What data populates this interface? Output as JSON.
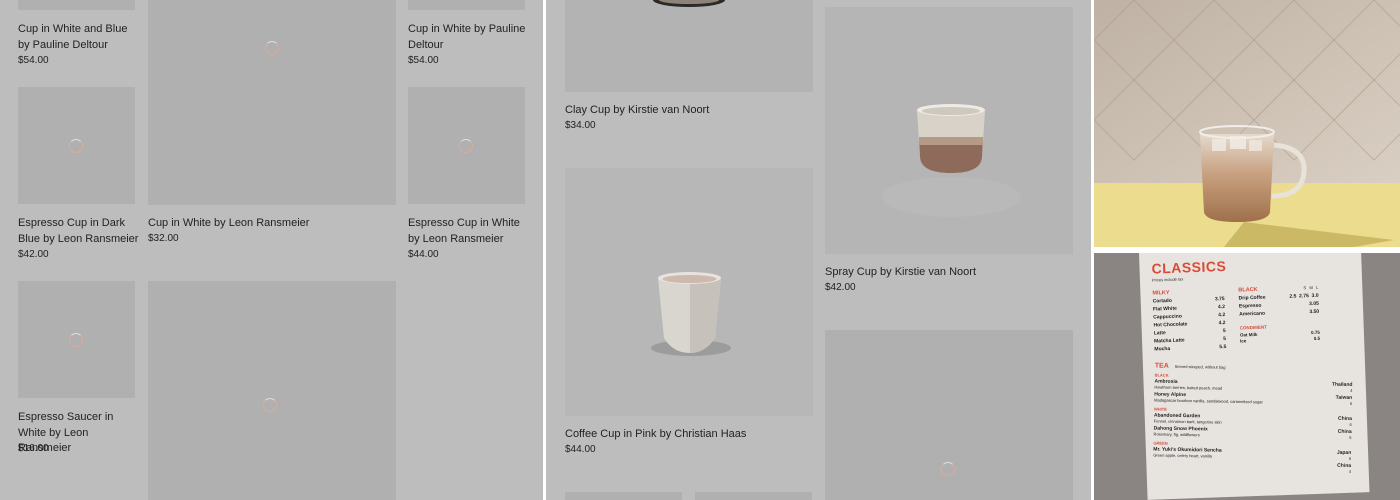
{
  "panel_a": {
    "products": [
      {
        "title": "Cup in White and Blue by Pauline Deltour",
        "price": "$54.00"
      },
      {
        "title": "Cup in White by Pauline Deltour",
        "price": "$54.00"
      },
      {
        "title": "Espresso Cup in Dark Blue by Leon Ransmeier",
        "price": "$42.00"
      },
      {
        "title": "Cup in White by Leon Ransmeier",
        "price": "$32.00"
      },
      {
        "title": "Espresso Cup in White by Leon Ransmeier",
        "price": "$44.00"
      },
      {
        "title": "Espresso Saucer in White by Leon Ransmeier",
        "price": "$16.00"
      }
    ]
  },
  "panel_b": {
    "products": [
      {
        "title": "Clay Cup by Kirstie van Noort",
        "price": "$34.00"
      },
      {
        "title": "Spray Cup by Kirstie van Noort",
        "price": "$42.00"
      },
      {
        "title": "Coffee Cup in Pink by Christian Haas",
        "price": "$44.00"
      }
    ]
  },
  "panel_c": {
    "menu": {
      "heading": "CLASSICS",
      "subheading": "Prices include tax",
      "milky_label": "MILKY",
      "milky_items": [
        {
          "name": "Cortado",
          "price": "3.75"
        },
        {
          "name": "Flat White",
          "price": "4.2"
        },
        {
          "name": "Cappuccino",
          "price": "4.2"
        },
        {
          "name": "Hot Chocolate",
          "price": "4.2"
        },
        {
          "name": "Latte",
          "price": "5"
        },
        {
          "name": "Matcha Latte",
          "price": "5"
        },
        {
          "name": "Mocha",
          "price": "5.5"
        }
      ],
      "black_label": "BLACK",
      "black_sizes": "S   M   L",
      "black_items": [
        {
          "name": "Drip Coffee",
          "price": "2.5  2.75  3.0"
        },
        {
          "name": "Espresso",
          "price": "3.05"
        },
        {
          "name": "Americano",
          "price": "3.50"
        }
      ],
      "condiment_label": "CONDIMENT",
      "condiment_items": [
        {
          "name": "Oat Milk",
          "price": "0.75"
        },
        {
          "name": "Ice",
          "price": "0.5"
        }
      ],
      "tea_label": "TEA",
      "tea_note": "Served steeped, without bag",
      "tea_black_label": "BLACK",
      "tea_items": [
        {
          "name": "Ambrosia",
          "desc": "Hawthorn berries, baked peach, mead",
          "origin": "Thailand",
          "price": "4"
        },
        {
          "name": "Honey Alpine",
          "desc": "Madagascar bourbon vanilla, sandalwood, caramelized sugar",
          "origin": "Taiwan",
          "price": "6"
        }
      ],
      "tea_white_label": "WHITE",
      "tea_white_items": [
        {
          "name": "Abandoned Garden",
          "desc": "Fennel, cinnamon bark, tangerine skin",
          "origin": "China",
          "price": "6"
        },
        {
          "name": "Dahong Snow Phoenix",
          "desc": "Rosemary, fig, wildflowers",
          "origin": "China",
          "price": "5"
        }
      ],
      "tea_green_label": "GREEN",
      "tea_green_items": [
        {
          "name": "Mr. Yuki's Okumidori Sencha",
          "desc": "Green apple, celery heart, vanilla",
          "origin": "Japan",
          "price": "6"
        },
        {
          "name": "",
          "desc": "",
          "origin": "China",
          "price": "4"
        }
      ]
    }
  },
  "colors": {
    "overlay_gray": "#bdbdbd",
    "tile_gray": "#b0b0b0",
    "menu_red": "#d94b37"
  }
}
